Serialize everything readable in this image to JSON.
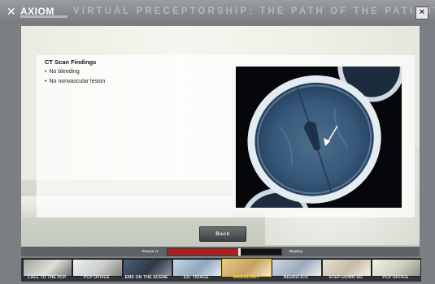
{
  "app": {
    "logo_text": "AXIOM",
    "title": "VIRTUAL PRECEPTORSHIP: THE PATH OF THE PATIENT",
    "close_label": "×"
  },
  "findings": {
    "title": "CT Scan Findings",
    "items": [
      "No bleeding",
      "No nonvascular lesion"
    ]
  },
  "back_button": "Back",
  "playback": {
    "pause_label": "Pause II",
    "replay_label": "Replay",
    "progress_fraction": 0.63
  },
  "steps": [
    {
      "label": "Call to the PCP",
      "colors": [
        "#9fa3a0",
        "#dfe0d9",
        "#6d7170"
      ]
    },
    {
      "label": "PCP Office",
      "colors": [
        "#f1f2ee",
        "#c9cdd0",
        "#8b7e72"
      ]
    },
    {
      "label": "EMS on the Scene",
      "colors": [
        "#4a6178",
        "#2e3945",
        "#8d95a1"
      ]
    },
    {
      "label": "ED: Triage",
      "colors": [
        "#c4d6e3",
        "#8da7bd",
        "#e8eef2"
      ]
    },
    {
      "label": "Radiology",
      "colors": [
        "#e6c98f",
        "#c5a060",
        "#f7ecd2"
      ],
      "active": true
    },
    {
      "label": "Neuro-ICU",
      "colors": [
        "#cfd8e3",
        "#98aabb",
        "#f1f1f1"
      ]
    },
    {
      "label": "Step-Down SU",
      "colors": [
        "#e7e1d2",
        "#c6bca7",
        "#f6f3ea"
      ]
    },
    {
      "label": "PCP Office",
      "colors": [
        "#f2f1e6",
        "#cfcfbf",
        "#8e8e84"
      ]
    }
  ]
}
